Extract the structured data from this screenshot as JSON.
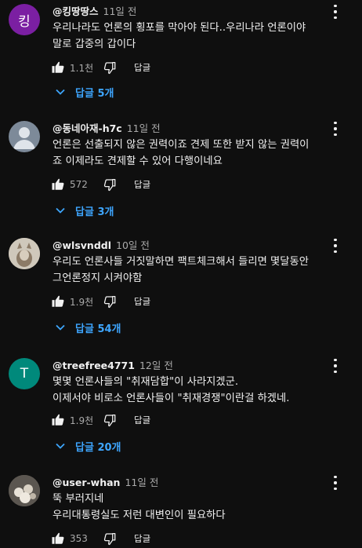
{
  "comments": [
    {
      "avatar_letter": "킹",
      "avatar_color": "#7b1fa2",
      "handle": "@킹땅땅스",
      "time": "11일 전",
      "text_lines": [
        "우리나라도 언론의 횡포를 막아야 된다..우리나라 언론이야",
        "말로 갑중의 갑이다"
      ],
      "likes": "1.1천",
      "reply_label": "답글",
      "replies_label": "답글 5개"
    },
    {
      "avatar_letter": "",
      "avatar_color": "#7d8a99",
      "handle": "@동네아재-h7c",
      "time": "11일 전",
      "text_lines": [
        "언론은 선출되지 않은 권력이죠 견제 또한 받지 않는 권력이",
        "죠 이제라도 견제할 수 있어 다행이네요"
      ],
      "likes": "572",
      "reply_label": "답글",
      "replies_label": "답글 3개"
    },
    {
      "avatar_letter": "",
      "avatar_color": "#c9c2b5",
      "handle": "@wlsvnddl",
      "time": "10일 전",
      "text_lines": [
        "우리도 언론사들 거짓말하면 팩트체크해서 들리면 몇달동안",
        "그언론정지 시켜야함"
      ],
      "likes": "1.9천",
      "reply_label": "답글",
      "replies_label": "답글 54개"
    },
    {
      "avatar_letter": "T",
      "avatar_color": "#00897b",
      "handle": "@treefree4771",
      "time": "12일 전",
      "text_lines": [
        "몇몇 언론사들의 \"취재담합\"이 사라지겠군.",
        "이제서야 비로소 언론사들이 \"취재경쟁\"이란걸 하겠네."
      ],
      "likes": "1.9천",
      "reply_label": "답글",
      "replies_label": "답글 20개"
    },
    {
      "avatar_letter": "",
      "avatar_color": "#6f6a62",
      "handle": "@user-whan",
      "time": "11일 전",
      "text_lines": [
        "뚝 부러지네",
        "우리대통령실도 저런 대변인이 필요하다"
      ],
      "likes": "353",
      "reply_label": "답글",
      "replies_label": ""
    }
  ]
}
